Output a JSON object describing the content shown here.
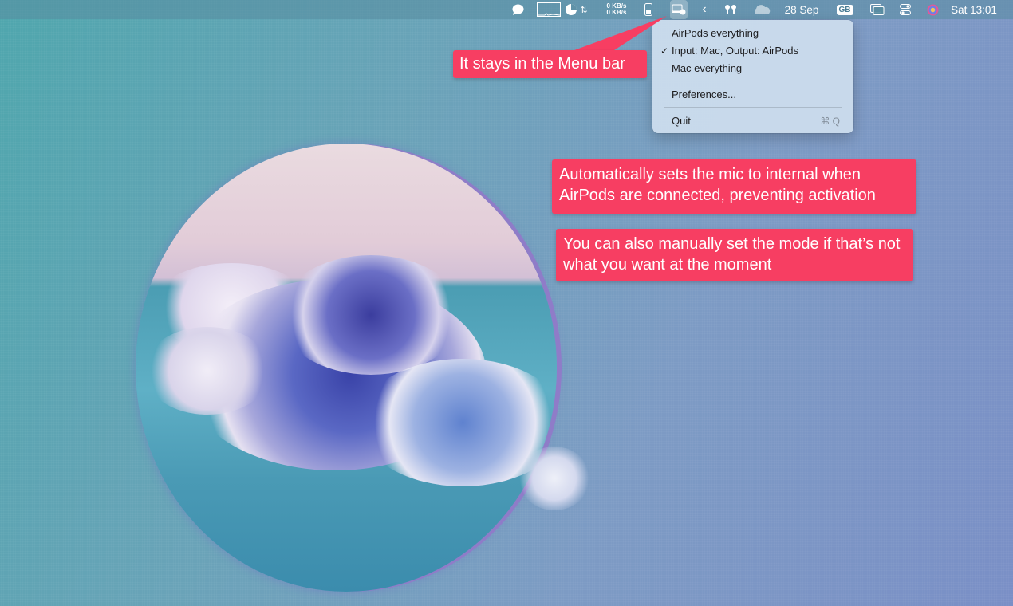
{
  "menubar": {
    "network_up": "0 KB/s",
    "network_down": "0 KB/s",
    "date": "28 Sep",
    "keyboard_layout": "GB",
    "clock": "Sat 13:01"
  },
  "menu": {
    "items": [
      {
        "label": "AirPods everything",
        "checked": false
      },
      {
        "label": "Input: Mac, Output: AirPods",
        "checked": true
      },
      {
        "label": "Mac everything",
        "checked": false
      }
    ],
    "preferences_label": "Preferences...",
    "quit_label": "Quit",
    "quit_shortcut": "⌘ Q",
    "check_mark": "✓"
  },
  "callouts": {
    "menu_bar": "It stays in the Menu bar",
    "auto_mic": "Automatically sets the mic to internal when AirPods are connected, preventing activation",
    "manual_mode": "You can also manually set the mode if that’s not what you want at the moment"
  },
  "colors": {
    "callout": "#f73e62",
    "menu_bg": "#cddeee"
  }
}
